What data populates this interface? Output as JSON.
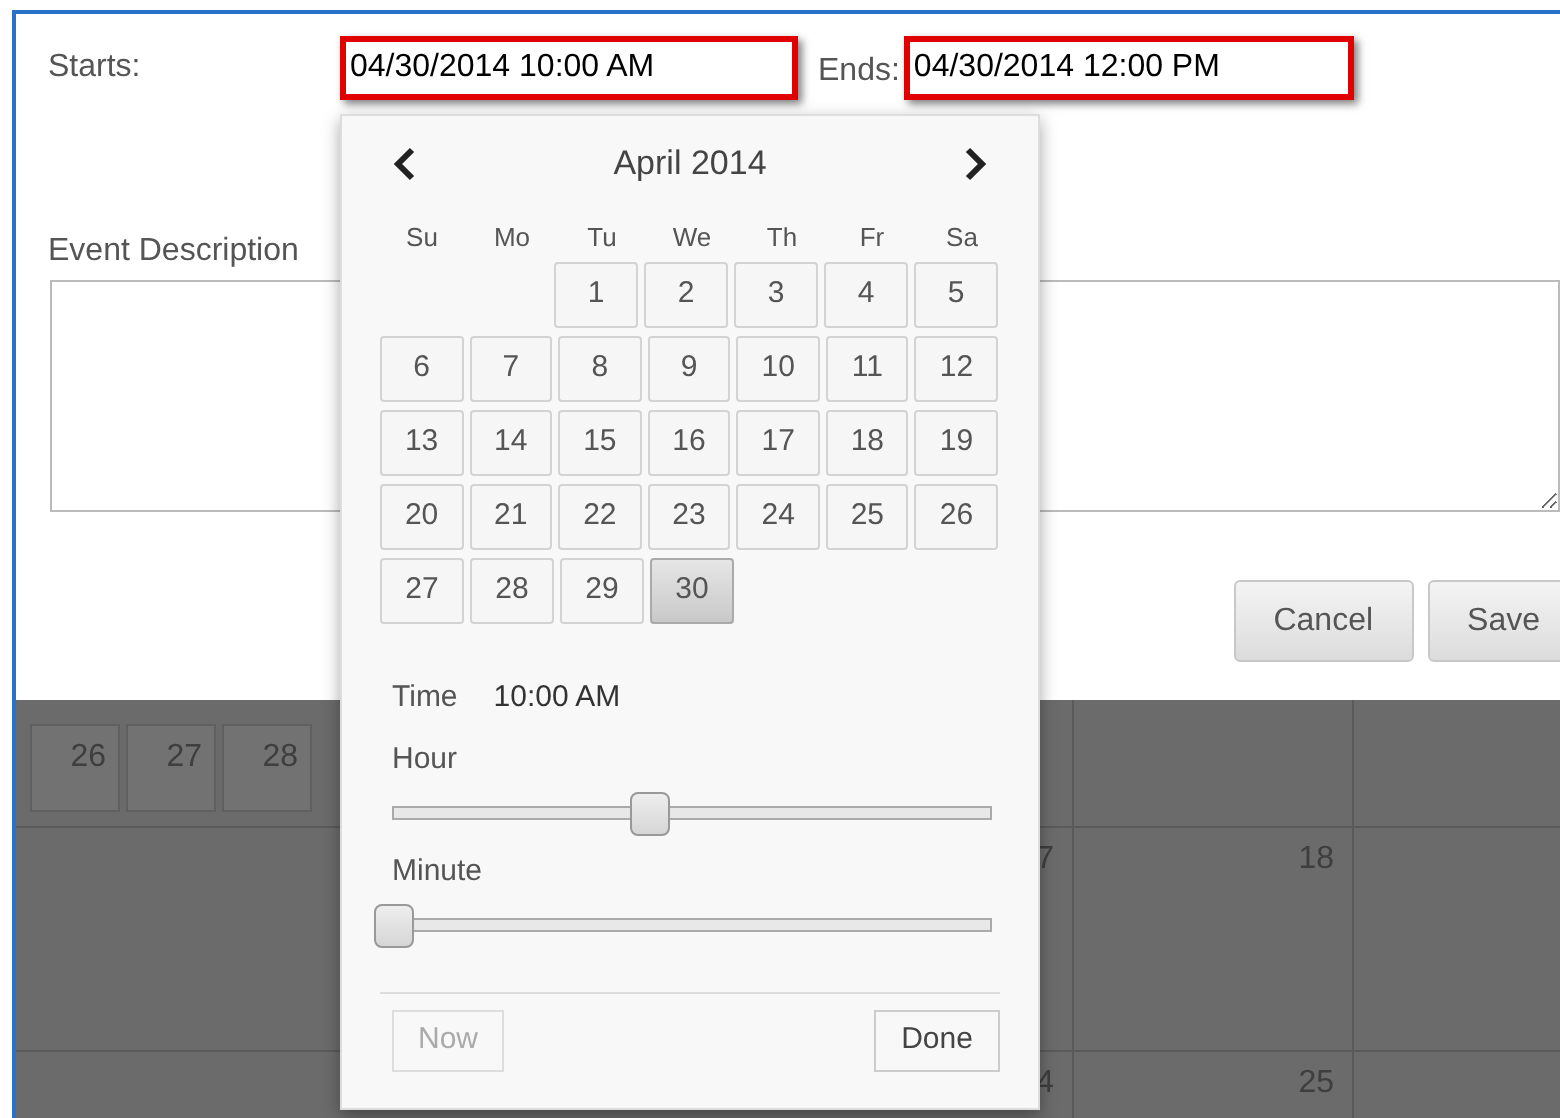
{
  "dialog": {
    "starts_label": "Starts:",
    "start_input": {
      "value": "04/30/2014 10:00 AM",
      "highlighted": true
    },
    "ends_label": "Ends:",
    "end_input": {
      "value": "04/30/2014 12:00 PM",
      "highlighted": true
    },
    "description_label": "Event Description",
    "buttons": [
      {
        "label": "Cancel"
      },
      {
        "label": "Save"
      }
    ]
  },
  "background": {
    "mini_cells": [
      "26",
      "27",
      "28"
    ],
    "cells": [
      "7",
      "18",
      "4",
      "25"
    ]
  },
  "datepicker": {
    "month_title": "April 2014",
    "weekdays": [
      "Su",
      "Mo",
      "Tu",
      "We",
      "Th",
      "Fr",
      "Sa"
    ],
    "weeks": [
      {
        "days": [
          {
            "label": "1",
            "selected": false
          },
          {
            "label": "2",
            "selected": false
          },
          {
            "label": "3",
            "selected": false
          },
          {
            "label": "4",
            "selected": false
          },
          {
            "label": "5",
            "selected": false
          }
        ]
      },
      {
        "days": [
          {
            "label": "6",
            "selected": false
          },
          {
            "label": "7",
            "selected": false
          },
          {
            "label": "8",
            "selected": false
          },
          {
            "label": "9",
            "selected": false
          },
          {
            "label": "10",
            "selected": false
          },
          {
            "label": "11",
            "selected": false
          },
          {
            "label": "12",
            "selected": false
          }
        ]
      },
      {
        "days": [
          {
            "label": "13",
            "selected": false
          },
          {
            "label": "14",
            "selected": false
          },
          {
            "label": "15",
            "selected": false
          },
          {
            "label": "16",
            "selected": false
          },
          {
            "label": "17",
            "selected": false
          },
          {
            "label": "18",
            "selected": false
          },
          {
            "label": "19",
            "selected": false
          }
        ]
      },
      {
        "days": [
          {
            "label": "20",
            "selected": false
          },
          {
            "label": "21",
            "selected": false
          },
          {
            "label": "22",
            "selected": false
          },
          {
            "label": "23",
            "selected": false
          },
          {
            "label": "24",
            "selected": false
          },
          {
            "label": "25",
            "selected": false
          },
          {
            "label": "26",
            "selected": false
          }
        ]
      },
      {
        "days": [
          {
            "label": "27",
            "selected": false
          },
          {
            "label": "28",
            "selected": false
          },
          {
            "label": "29",
            "selected": false
          },
          {
            "label": "30",
            "selected": true
          }
        ]
      }
    ],
    "time_label": "Time",
    "time_value": "10:00 AM",
    "sliders": [
      {
        "label": "Hour",
        "level": 0.43
      },
      {
        "label": "Minute",
        "level": 0
      }
    ],
    "now_button": {
      "label": "Now",
      "disabled": true
    },
    "done_button": {
      "label": "Done",
      "disabled": false
    }
  }
}
